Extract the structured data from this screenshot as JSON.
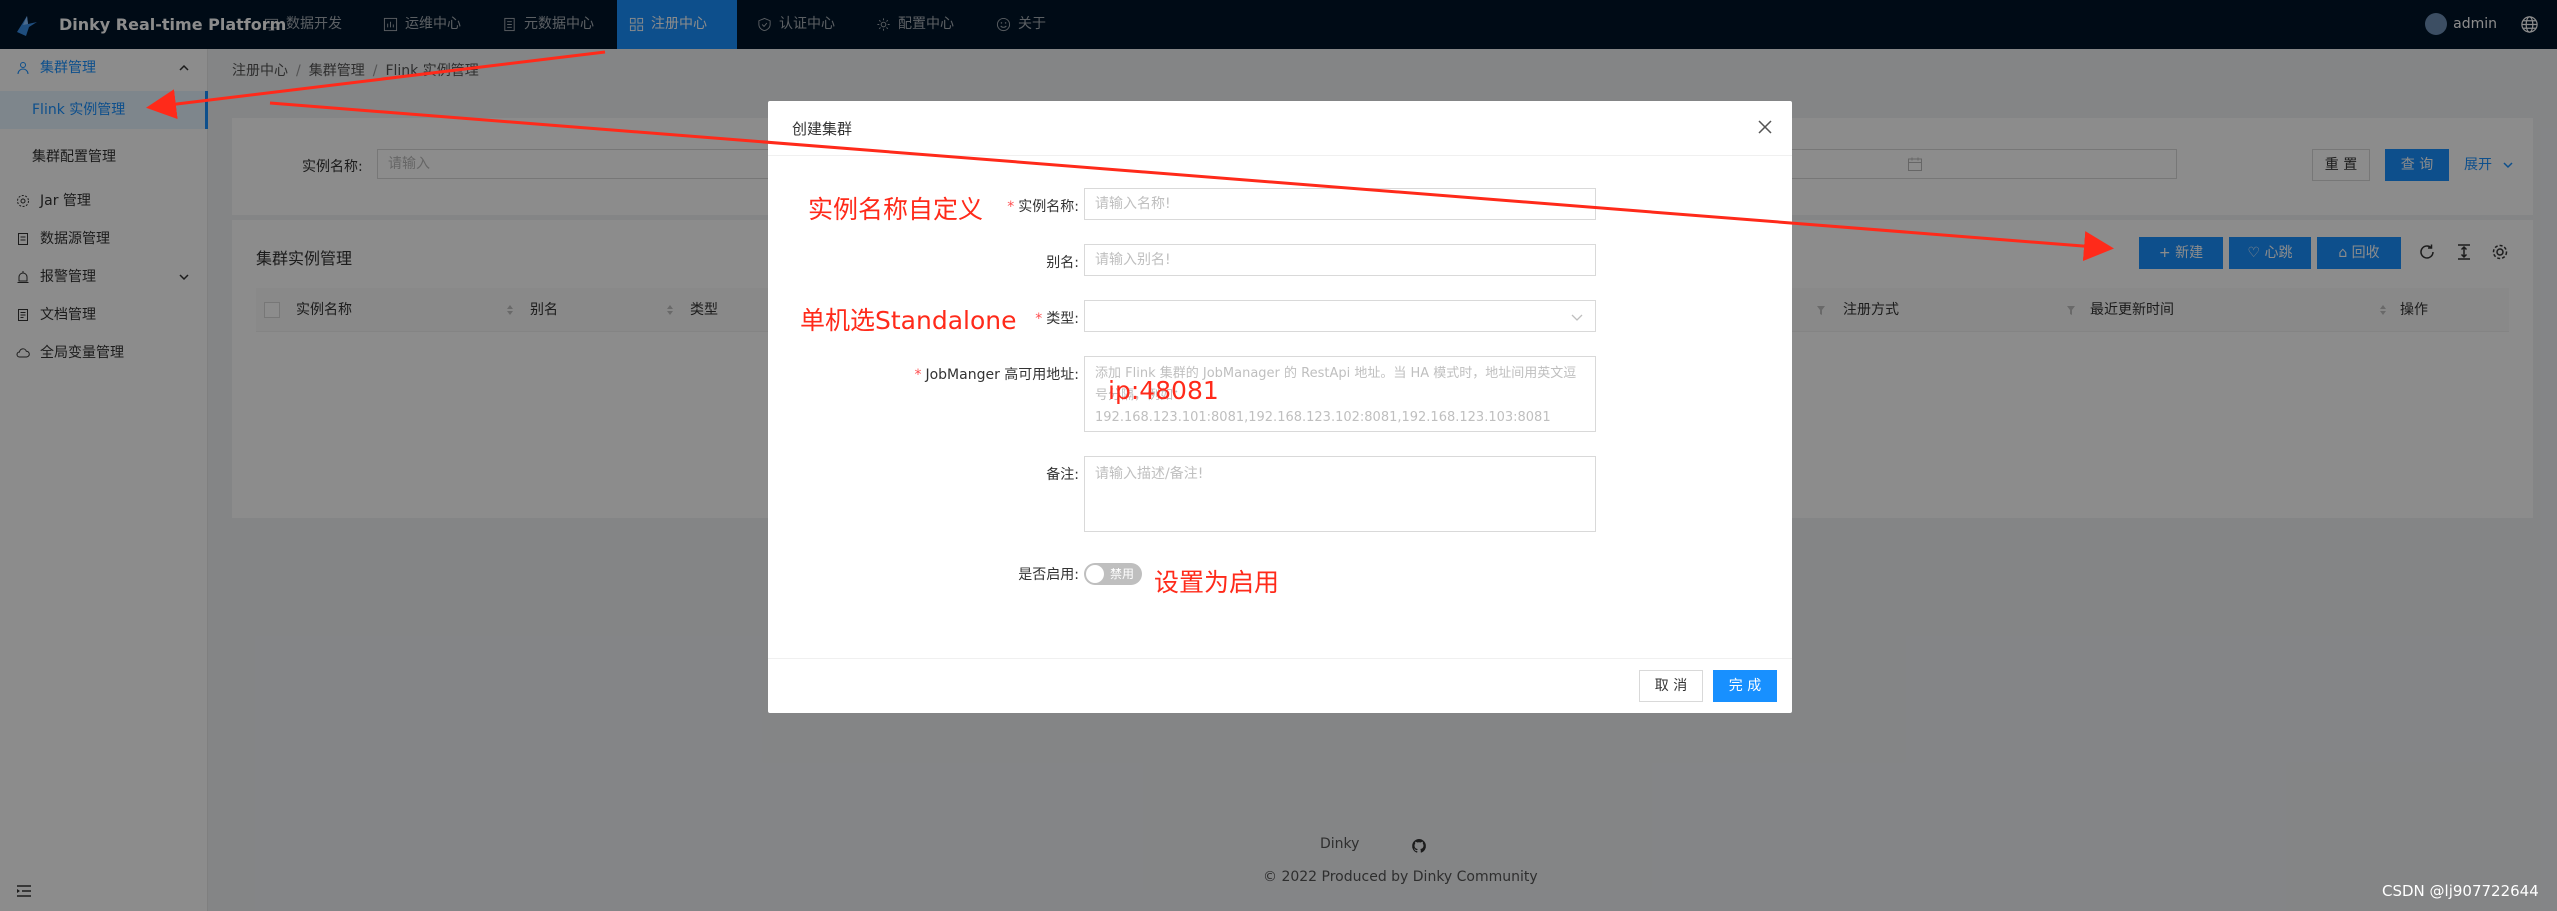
{
  "app": {
    "title": "Dinky Real-time Platform"
  },
  "topnav": {
    "items": [
      {
        "label": "数据开发",
        "icon": "code-icon"
      },
      {
        "label": "运维中心",
        "icon": "dashboard-icon"
      },
      {
        "label": "元数据中心",
        "icon": "database-icon"
      },
      {
        "label": "注册中心",
        "icon": "appstore-icon",
        "active": true
      },
      {
        "label": "认证中心",
        "icon": "shield-icon"
      },
      {
        "label": "配置中心",
        "icon": "setting-icon"
      },
      {
        "label": "关于",
        "icon": "smile-icon"
      }
    ],
    "user": "admin"
  },
  "sidebar": {
    "items": [
      {
        "label": "集群管理",
        "icon": "cluster-icon",
        "open": true
      },
      {
        "label": "Flink 实例管理",
        "sub": true,
        "selected": true
      },
      {
        "label": "集群配置管理",
        "sub": true
      },
      {
        "label": "Jar 管理",
        "icon": "jar-icon"
      },
      {
        "label": "数据源管理",
        "icon": "datasource-icon"
      },
      {
        "label": "报警管理",
        "icon": "alert-icon",
        "has_children": true
      },
      {
        "label": "文档管理",
        "icon": "doc-icon"
      },
      {
        "label": "全局变量管理",
        "icon": "cloud-icon"
      }
    ]
  },
  "breadcrumb": [
    "注册中心",
    "集群管理",
    "Flink 实例管理"
  ],
  "search": {
    "label": "实例名称:",
    "placeholder": "请输入",
    "reset_label": "重 置",
    "query_label": "查 询",
    "expand_label": "展开"
  },
  "table": {
    "title": "集群实例管理",
    "new_label": "新建",
    "heartbeat_label": "心跳",
    "recycle_label": "回收",
    "columns": [
      "实例名称",
      "别名",
      "类型",
      "注册方式",
      "最近更新时间",
      "操作"
    ]
  },
  "footer": {
    "brand": "Dinky",
    "copyright": "2022 Produced by Dinky Community"
  },
  "watermark": "CSDN @lj907722644",
  "modal": {
    "title": "创建集群",
    "fields": {
      "name": {
        "label": "实例名称",
        "placeholder": "请输入名称!",
        "required": true
      },
      "alias": {
        "label": "别名",
        "placeholder": "请输入别名!",
        "required": false
      },
      "type": {
        "label": "类型",
        "value": "",
        "required": true
      },
      "hosts": {
        "label": "JobManger 高可用地址",
        "placeholder": "添加 Flink 集群的 JobManager 的 RestApi 地址。当 HA 模式时，地址间用英文逗号分隔，例如：192.168.123.101:8081,192.168.123.102:8081,192.168.123.103:8081",
        "required": true
      },
      "note": {
        "label": "备注",
        "placeholder": "请输入描述/备注!",
        "required": false
      },
      "enabled": {
        "label": "是否启用",
        "toggle_text": "禁用",
        "value": false
      }
    },
    "cancel_label": "取 消",
    "ok_label": "完 成"
  },
  "annotations": {
    "name_note": "实例名称自定义",
    "type_note": "单机选Standalone",
    "hosts_note": "ip:48081",
    "enable_note": "设置为启用"
  },
  "colors": {
    "primary": "#1890ff",
    "header_bg": "#001529",
    "annotation": "#ff2a1a"
  }
}
